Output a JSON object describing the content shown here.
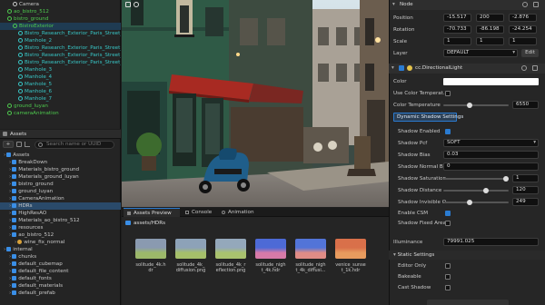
{
  "hierarchy": {
    "rows": [
      {
        "label": "Camera",
        "color": "#c8c8c8",
        "indent": 14
      },
      {
        "label": "ao_bistro_512",
        "color": "#4ec94e",
        "indent": 8
      },
      {
        "label": "bistro_ground",
        "color": "#4ec94e",
        "indent": 8
      },
      {
        "label": "BistroExterior",
        "color": "#4ec94e",
        "indent": 14
      },
      {
        "label": "Bistro_Research_Exterior_Paris_Street_...",
        "color": "#38c6c6",
        "indent": 20
      },
      {
        "label": "Manhole_2",
        "color": "#38c6c6",
        "indent": 20
      },
      {
        "label": "Bistro_Research_Exterior_Paris_Street_...",
        "color": "#38c6c6",
        "indent": 20
      },
      {
        "label": "Bistro_Research_Exterior_Paris_Street_...",
        "color": "#38c6c6",
        "indent": 20
      },
      {
        "label": "Bistro_Research_Exterior_Paris_Street_...",
        "color": "#38c6c6",
        "indent": 20
      },
      {
        "label": "Manhole_3",
        "color": "#38c6c6",
        "indent": 20
      },
      {
        "label": "Manhole_4",
        "color": "#38c6c6",
        "indent": 20
      },
      {
        "label": "Manhole_5",
        "color": "#38c6c6",
        "indent": 20
      },
      {
        "label": "Manhole_6",
        "color": "#38c6c6",
        "indent": 20
      },
      {
        "label": "Manhole_7",
        "color": "#38c6c6",
        "indent": 20
      },
      {
        "label": "ground_luyan",
        "color": "#4ec94e",
        "indent": 8
      },
      {
        "label": "cameraAnimation",
        "color": "#4ec94e",
        "indent": 8
      }
    ]
  },
  "assets": {
    "title": "Assets",
    "search_placeholder": "Search name or UUID",
    "rows": [
      {
        "label": "Assets",
        "indent": 4
      },
      {
        "label": "BreakDown",
        "indent": 10
      },
      {
        "label": "Materials_bistro_ground",
        "indent": 10
      },
      {
        "label": "Materials_ground_luyan",
        "indent": 10
      },
      {
        "label": "bistro_ground",
        "indent": 10
      },
      {
        "label": "ground_luyan",
        "indent": 10
      },
      {
        "label": "CameraAnimation",
        "indent": 10
      },
      {
        "label": "HDRs",
        "indent": 10
      },
      {
        "label": "HighResAO",
        "indent": 10
      },
      {
        "label": "Materials_ao_bistro_512",
        "indent": 10
      },
      {
        "label": "resources",
        "indent": 10
      },
      {
        "label": "ao_bistro_512",
        "indent": 10
      },
      {
        "label": "wine_fix_normal",
        "indent": 16
      },
      {
        "label": "internal",
        "indent": 4
      },
      {
        "label": "chunks",
        "indent": 10
      },
      {
        "label": "default_cubemap",
        "indent": 10
      },
      {
        "label": "default_file_content",
        "indent": 10
      },
      {
        "label": "default_fonts",
        "indent": 10
      },
      {
        "label": "default_materials",
        "indent": 10
      },
      {
        "label": "default_prefab",
        "indent": 10
      }
    ]
  },
  "bottom_tabs": [
    "Assets Preview",
    "Console",
    "Animation"
  ],
  "breadcrumb": "assets/HDRs",
  "preview_items": [
    {
      "name": "solitude_4k.hdr",
      "lines": [
        "solitude_4k.h",
        "dr"
      ],
      "top": "#8a9ab0",
      "bottom": "#9cb86a"
    },
    {
      "name": "solitude_4k_diffusion.png",
      "lines": [
        "solitude_4k_",
        "diffusion.png"
      ],
      "top": "#8da2b8",
      "bottom": "#a5bf6a"
    },
    {
      "name": "solitude_4k_reflection.png",
      "lines": [
        "solitude_4k_r",
        "eflection.png"
      ],
      "top": "#94a8bb",
      "bottom": "#a9c26e"
    },
    {
      "name": "solitude_night_4k.hdr",
      "lines": [
        "solitude_nigh",
        "t_4k.hdr"
      ],
      "top": "#4d6ad6",
      "bottom": "#d77aa8"
    },
    {
      "name": "solitude_night_4k_diffusi...",
      "lines": [
        "solitude_nigh",
        "t_4k_diffusi..."
      ],
      "top": "#5274d8",
      "bottom": "#e08c86"
    },
    {
      "name": "venice_sunset_1k.hdr",
      "lines": [
        "venice_sunse",
        "t_1k.hdr"
      ],
      "top": "#d9704a",
      "bottom": "#e79b5e"
    }
  ],
  "inspector": {
    "node_title": "Node",
    "position_label": "Position",
    "position": [
      "-15.517",
      "200",
      "-2.876"
    ],
    "rotation_label": "Rotation",
    "rotation": [
      "-70.733",
      "-86.198",
      "-24.254"
    ],
    "scale_label": "Scale",
    "scale": [
      "1",
      "1",
      "1"
    ],
    "layer_label": "Layer",
    "layer_value": "DEFAULT",
    "edit_label": "Edit",
    "component_title": "cc.DirectionalLight",
    "color_label": "Color",
    "use_color_temp_label": "Use Color Temperat...",
    "color_temp_label": "Color Temperature",
    "color_temp_value": "6550",
    "dynamic_shadow_tab": "Dynamic Shadow Settings",
    "shadow_enabled_label": "Shadow Enabled",
    "shadow_pcf_label": "Shadow Pcf",
    "shadow_pcf_value": "SOFT",
    "shadow_bias_label": "Shadow Bias",
    "shadow_bias_value": "0.03",
    "shadow_normal_bias_label": "Shadow Normal Bias",
    "shadow_normal_bias_value": "0",
    "shadow_saturation_label": "Shadow Saturation",
    "shadow_saturation_value": "1",
    "shadow_distance_label": "Shadow Distance",
    "shadow_distance_value": "120",
    "shadow_invisible_label": "Shadow Invisible O...",
    "shadow_invisible_value": "249",
    "enable_csm_label": "Enable CSM",
    "shadow_fixed_area_label": "Shadow Fixed Area",
    "illuminance_label": "Illuminance",
    "illuminance_value": "79991.025",
    "static_settings_title": "Static Settings",
    "editor_only_label": "Editor Only",
    "bakeable_label": "Bakeable",
    "cast_shadow_label": "Cast Shadow"
  },
  "colors": {
    "accent": "#2a7bd1",
    "green": "#4ec94e",
    "cyan": "#38c6c6",
    "folder": "#3a8ee6"
  }
}
